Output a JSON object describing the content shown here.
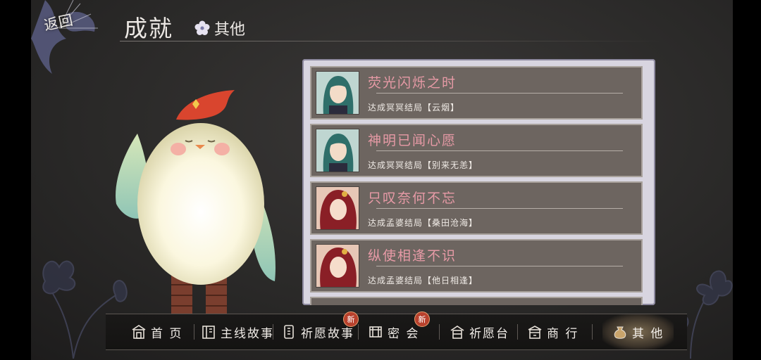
{
  "header": {
    "back_label": "返回",
    "title": "成就",
    "subtitle": "其他"
  },
  "achievements": [
    {
      "title": "荧光闪烁之时",
      "desc": "达成冥冥结局【云烟】",
      "character": "green-haired-man"
    },
    {
      "title": "神明已闻心愿",
      "desc": "达成冥冥结局【别来无恙】",
      "character": "green-haired-man"
    },
    {
      "title": "只叹奈何不忘",
      "desc": "达成孟婆结局【桑田沧海】",
      "character": "red-haired-woman"
    },
    {
      "title": "纵使相逢不识",
      "desc": "达成孟婆结局【他日相逢】",
      "character": "red-haired-woman"
    }
  ],
  "nav": {
    "items": [
      {
        "label": "首 页",
        "icon": "home-gate-icon"
      },
      {
        "label": "主线故事",
        "icon": "book-icon"
      },
      {
        "label": "祈愿故事",
        "icon": "wish-card-icon",
        "badge": "新"
      },
      {
        "label": "密 会",
        "icon": "meeting-icon",
        "badge": "新"
      },
      {
        "label": "祈愿台",
        "icon": "altar-icon"
      },
      {
        "label": "商 行",
        "icon": "shop-icon"
      },
      {
        "label": "其 他",
        "icon": "pouch-icon",
        "active": true
      }
    ]
  },
  "colors": {
    "accent_title": "#e79aa6",
    "card_bg": "#6d6560",
    "panel_bg": "#d8d5e0",
    "badge": "#b8412d"
  }
}
